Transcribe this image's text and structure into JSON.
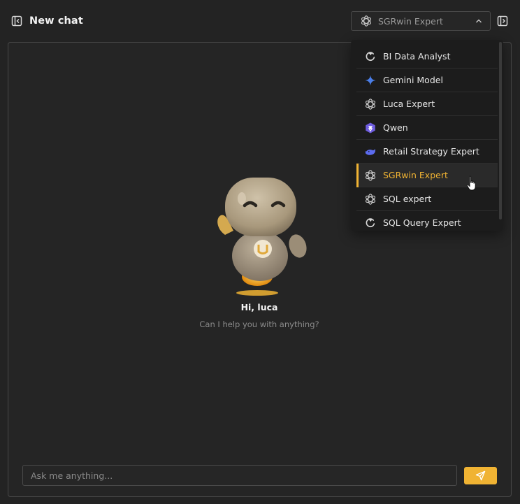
{
  "header": {
    "title": "New chat",
    "collapse_icon": "sidebar-collapse-icon",
    "right_panel_icon": "sidebar-expand-icon"
  },
  "model_selector": {
    "selected": "SGRwin Expert",
    "icon": "openai-icon",
    "chevron": "chevron-up-icon"
  },
  "dropdown": {
    "items": [
      {
        "label": "BI Data Analyst",
        "icon": "loop-icon"
      },
      {
        "label": "Gemini Model",
        "icon": "gemini-sparkle-icon"
      },
      {
        "label": "Luca Expert",
        "icon": "openai-icon"
      },
      {
        "label": "Qwen",
        "icon": "qwen-icon"
      },
      {
        "label": "Retail Strategy Expert",
        "icon": "whale-icon"
      },
      {
        "label": "SGRwin Expert",
        "icon": "openai-icon",
        "selected": true
      },
      {
        "label": "SQL expert",
        "icon": "openai-icon"
      },
      {
        "label": "SQL Query Expert",
        "icon": "loop-icon"
      }
    ]
  },
  "welcome": {
    "greeting": "Hi, luca",
    "subtext": "Can I help you with anything?",
    "mascot": "robot-mascot-image"
  },
  "composer": {
    "placeholder": "Ask me anything...",
    "send_icon": "send-icon"
  },
  "colors": {
    "accent": "#f0b333",
    "background": "#232323",
    "dropdown_bg": "#1c1c1c",
    "gemini_blue": "#4a7ee8",
    "qwen_purple": "#6f5de0"
  }
}
